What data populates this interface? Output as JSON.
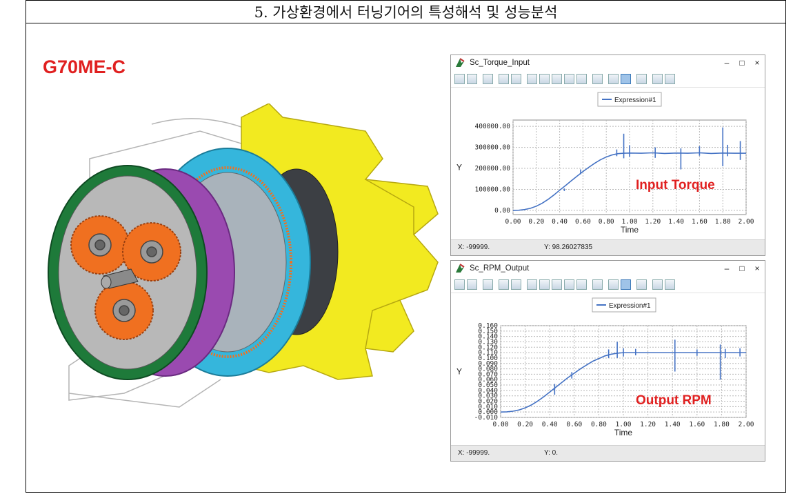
{
  "header": {
    "title": "5. 가상환경에서 터닝기어의 특성해석 및 성능분석"
  },
  "model": {
    "label": "G70ME-C"
  },
  "colors": {
    "accent_red": "#e02020",
    "series_blue": "#4472c4",
    "gear_yellow": "#f2ea20",
    "ring_cyan": "#35b6dc",
    "gear_orange": "#f07020",
    "plate_green": "#1e7a3a",
    "plate_purple": "#9a4ab0"
  },
  "windows": [
    {
      "title": "Sc_Torque_Input",
      "controls": [
        "–",
        "□",
        "×"
      ],
      "legend": "Expression#1",
      "annotation": "Input Torque",
      "status": {
        "x": "X:  -99999.",
        "y": "Y:  98.26027835"
      }
    },
    {
      "title": "Sc_RPM_Output",
      "controls": [
        "–",
        "□",
        "×"
      ],
      "legend": "Expression#1",
      "annotation": "Output RPM",
      "status": {
        "x": "X:  -99999.",
        "y": "Y:  0."
      }
    }
  ],
  "toolbar_icons": [
    "open-icon",
    "copy-icon",
    "plot-icon",
    "zoom-icon",
    "zoom-fit-icon",
    "stats-icon",
    "grid-icon",
    "pan-h-icon",
    "pan-v-icon",
    "export-icon",
    "erase-icon",
    "chart-settings-icon",
    "table-icon",
    "tools-icon",
    "marker-icon",
    "layout-icon"
  ],
  "chart_data": [
    {
      "type": "line",
      "title": "",
      "xlabel": "Time",
      "ylabel": "Y",
      "xlim": [
        0.0,
        2.0
      ],
      "ylim": [
        -20000,
        430000
      ],
      "x_ticks": [
        "0.00",
        "0.20",
        "0.40",
        "0.60",
        "0.80",
        "1.00",
        "1.20",
        "1.40",
        "1.60",
        "1.80",
        "2.00"
      ],
      "y_ticks": [
        "0.00",
        "100000.00",
        "200000.00",
        "300000.00",
        "400000.00"
      ],
      "y_tick_values": [
        0,
        100000,
        200000,
        300000,
        400000
      ],
      "legend": "top-center",
      "grid": true,
      "series": [
        {
          "name": "Expression#1",
          "x": [
            0.0,
            0.05,
            0.1,
            0.15,
            0.2,
            0.25,
            0.3,
            0.35,
            0.4,
            0.45,
            0.5,
            0.55,
            0.6,
            0.65,
            0.7,
            0.75,
            0.8,
            0.85,
            0.9,
            0.95,
            1.0,
            1.1,
            1.2,
            1.3,
            1.4,
            1.5,
            1.6,
            1.7,
            1.8,
            1.9,
            2.0
          ],
          "y": [
            0,
            800,
            4000,
            10000,
            20000,
            34000,
            52000,
            73000,
            96000,
            118000,
            141000,
            163000,
            185000,
            205000,
            224000,
            241000,
            254000,
            264000,
            270000,
            272000,
            273000,
            272000,
            274000,
            271000,
            273000,
            272000,
            274000,
            271000,
            273000,
            272000,
            272000
          ]
        }
      ],
      "spikes": [
        {
          "x": 0.44,
          "y": [
            104000,
            92000
          ]
        },
        {
          "x": 0.58,
          "y": [
            195000,
            172000
          ]
        },
        {
          "x": 0.89,
          "y": [
            290000,
            258000
          ]
        },
        {
          "x": 0.95,
          "y": [
            365000,
            248000
          ]
        },
        {
          "x": 1.0,
          "y": [
            310000,
            255000
          ]
        },
        {
          "x": 1.22,
          "y": [
            300000,
            250000
          ]
        },
        {
          "x": 1.44,
          "y": [
            295000,
            195000
          ]
        },
        {
          "x": 1.6,
          "y": [
            305000,
            260000
          ]
        },
        {
          "x": 1.8,
          "y": [
            395000,
            210000
          ]
        },
        {
          "x": 1.84,
          "y": [
            312000,
            258000
          ]
        },
        {
          "x": 1.95,
          "y": [
            330000,
            240000
          ]
        }
      ]
    },
    {
      "type": "line",
      "title": "",
      "xlabel": "Time",
      "ylabel": "Y",
      "xlim": [
        0.0,
        2.0
      ],
      "ylim": [
        -0.01,
        0.16
      ],
      "x_ticks": [
        "0.00",
        "0.20",
        "0.40",
        "0.60",
        "0.80",
        "1.00",
        "1.20",
        "1.40",
        "1.60",
        "1.80",
        "2.00"
      ],
      "y_ticks": [
        "-0.010",
        "0.000",
        "0.010",
        "0.020",
        "0.030",
        "0.040",
        "0.050",
        "0.060",
        "0.070",
        "0.080",
        "0.090",
        "0.100",
        "0.110",
        "0.120",
        "0.130",
        "0.140",
        "0.150",
        "0.160"
      ],
      "y_tick_values": [
        -0.01,
        0.0,
        0.01,
        0.02,
        0.03,
        0.04,
        0.05,
        0.06,
        0.07,
        0.08,
        0.09,
        0.1,
        0.11,
        0.12,
        0.13,
        0.14,
        0.15,
        0.16
      ],
      "legend": "top-center",
      "grid": true,
      "series": [
        {
          "name": "Expression#1",
          "x": [
            0.0,
            0.05,
            0.1,
            0.15,
            0.2,
            0.25,
            0.3,
            0.35,
            0.4,
            0.45,
            0.5,
            0.55,
            0.6,
            0.65,
            0.7,
            0.75,
            0.8,
            0.85,
            0.9,
            0.95,
            1.0,
            1.1,
            1.2,
            1.3,
            1.4,
            1.5,
            1.6,
            1.7,
            1.8,
            1.9,
            2.0
          ],
          "y": [
            0.0,
            0.0003,
            0.0015,
            0.0038,
            0.0077,
            0.013,
            0.02,
            0.028,
            0.037,
            0.046,
            0.055,
            0.064,
            0.072,
            0.08,
            0.087,
            0.094,
            0.099,
            0.104,
            0.107,
            0.109,
            0.11,
            0.11,
            0.11,
            0.11,
            0.11,
            0.11,
            0.11,
            0.11,
            0.11,
            0.11,
            0.11
          ]
        }
      ],
      "spikes": [
        {
          "x": 0.44,
          "y": [
            0.052,
            0.032
          ]
        },
        {
          "x": 0.58,
          "y": [
            0.074,
            0.062
          ]
        },
        {
          "x": 0.88,
          "y": [
            0.116,
            0.1
          ]
        },
        {
          "x": 0.95,
          "y": [
            0.13,
            0.1
          ]
        },
        {
          "x": 1.0,
          "y": [
            0.118,
            0.103
          ]
        },
        {
          "x": 1.1,
          "y": [
            0.117,
            0.105
          ]
        },
        {
          "x": 1.42,
          "y": [
            0.134,
            0.075
          ]
        },
        {
          "x": 1.6,
          "y": [
            0.116,
            0.104
          ]
        },
        {
          "x": 1.79,
          "y": [
            0.125,
            0.06
          ]
        },
        {
          "x": 1.83,
          "y": [
            0.117,
            0.1
          ]
        },
        {
          "x": 1.95,
          "y": [
            0.118,
            0.103
          ]
        }
      ]
    }
  ]
}
